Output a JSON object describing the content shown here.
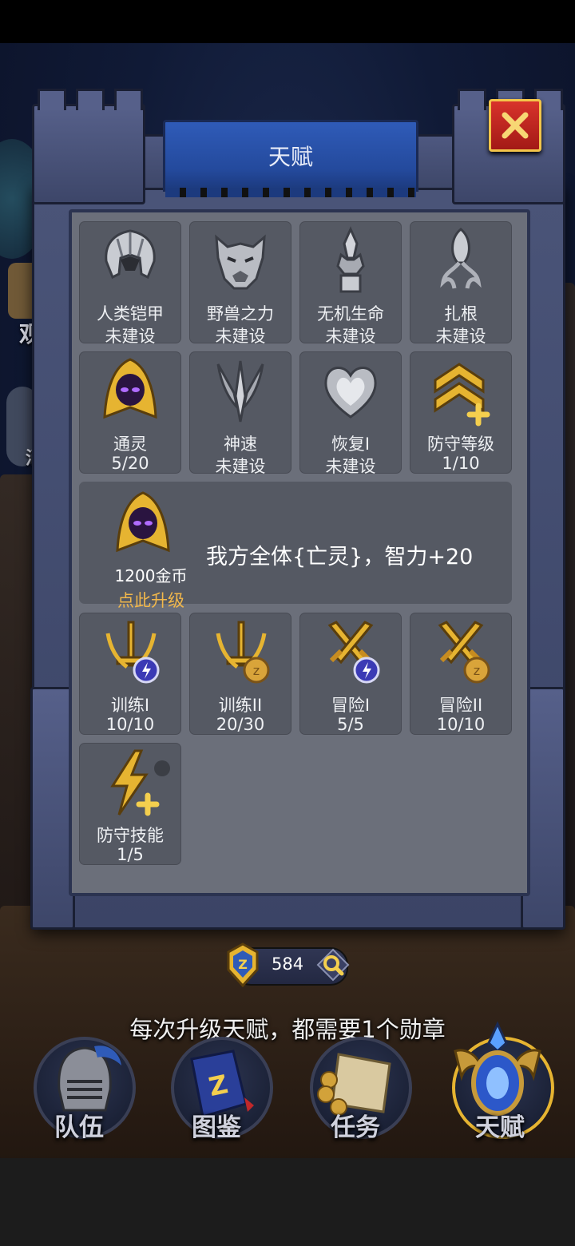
{
  "window": {
    "title": "天赋"
  },
  "background": {
    "side_labels": [
      "观",
      "消"
    ]
  },
  "talents_row1": [
    {
      "name": "人类铠甲",
      "status": "未建设",
      "icon": "helmet-icon"
    },
    {
      "name": "野兽之力",
      "status": "未建设",
      "icon": "beast-head-icon"
    },
    {
      "name": "无机生命",
      "status": "未建设",
      "icon": "crystal-claw-icon"
    },
    {
      "name": "扎根",
      "status": "未建设",
      "icon": "root-seed-icon"
    }
  ],
  "talents_row2": [
    {
      "name": "通灵",
      "status": "5/20",
      "icon": "hooded-spirit-icon"
    },
    {
      "name": "神速",
      "status": "未建设",
      "icon": "trident-speed-icon"
    },
    {
      "name": "恢复I",
      "status": "未建设",
      "icon": "heart-icon"
    },
    {
      "name": "防守等级",
      "status": "1/10",
      "icon": "rank-chevron-plus-icon"
    }
  ],
  "detail": {
    "icon": "hooded-spirit-icon",
    "cost": "1200金币",
    "upgrade_label": "点此升级",
    "description": "我方全体{亡灵}，智力+20"
  },
  "talents_row3": [
    {
      "name": "训练I",
      "status": "10/10",
      "icon": "sword-energy-icon"
    },
    {
      "name": "训练II",
      "status": "20/30",
      "icon": "sword-coin-icon"
    },
    {
      "name": "冒险I",
      "status": "5/5",
      "icon": "crossed-swords-energy-icon"
    },
    {
      "name": "冒险II",
      "status": "10/10",
      "icon": "crossed-swords-coin-icon"
    }
  ],
  "talents_row4": [
    {
      "name": "防守技能",
      "status": "1/5",
      "icon": "lightning-plus-icon"
    }
  ],
  "medal": {
    "count": "584",
    "icon": "medal-icon",
    "search_icon": "magnifier-icon"
  },
  "hint": "每次升级天赋，都需要1个勋章",
  "nav": [
    {
      "label": "队伍",
      "icon": "knight-helmet-icon"
    },
    {
      "label": "图鉴",
      "icon": "book-icon"
    },
    {
      "label": "任务",
      "icon": "scroll-icon"
    },
    {
      "label": "天赋",
      "icon": "talent-crest-icon"
    }
  ],
  "colors": {
    "upgrade": "#f2b84b",
    "banner": "#2f5bb8",
    "close": "#d8332b",
    "gold": "#e6b431"
  }
}
